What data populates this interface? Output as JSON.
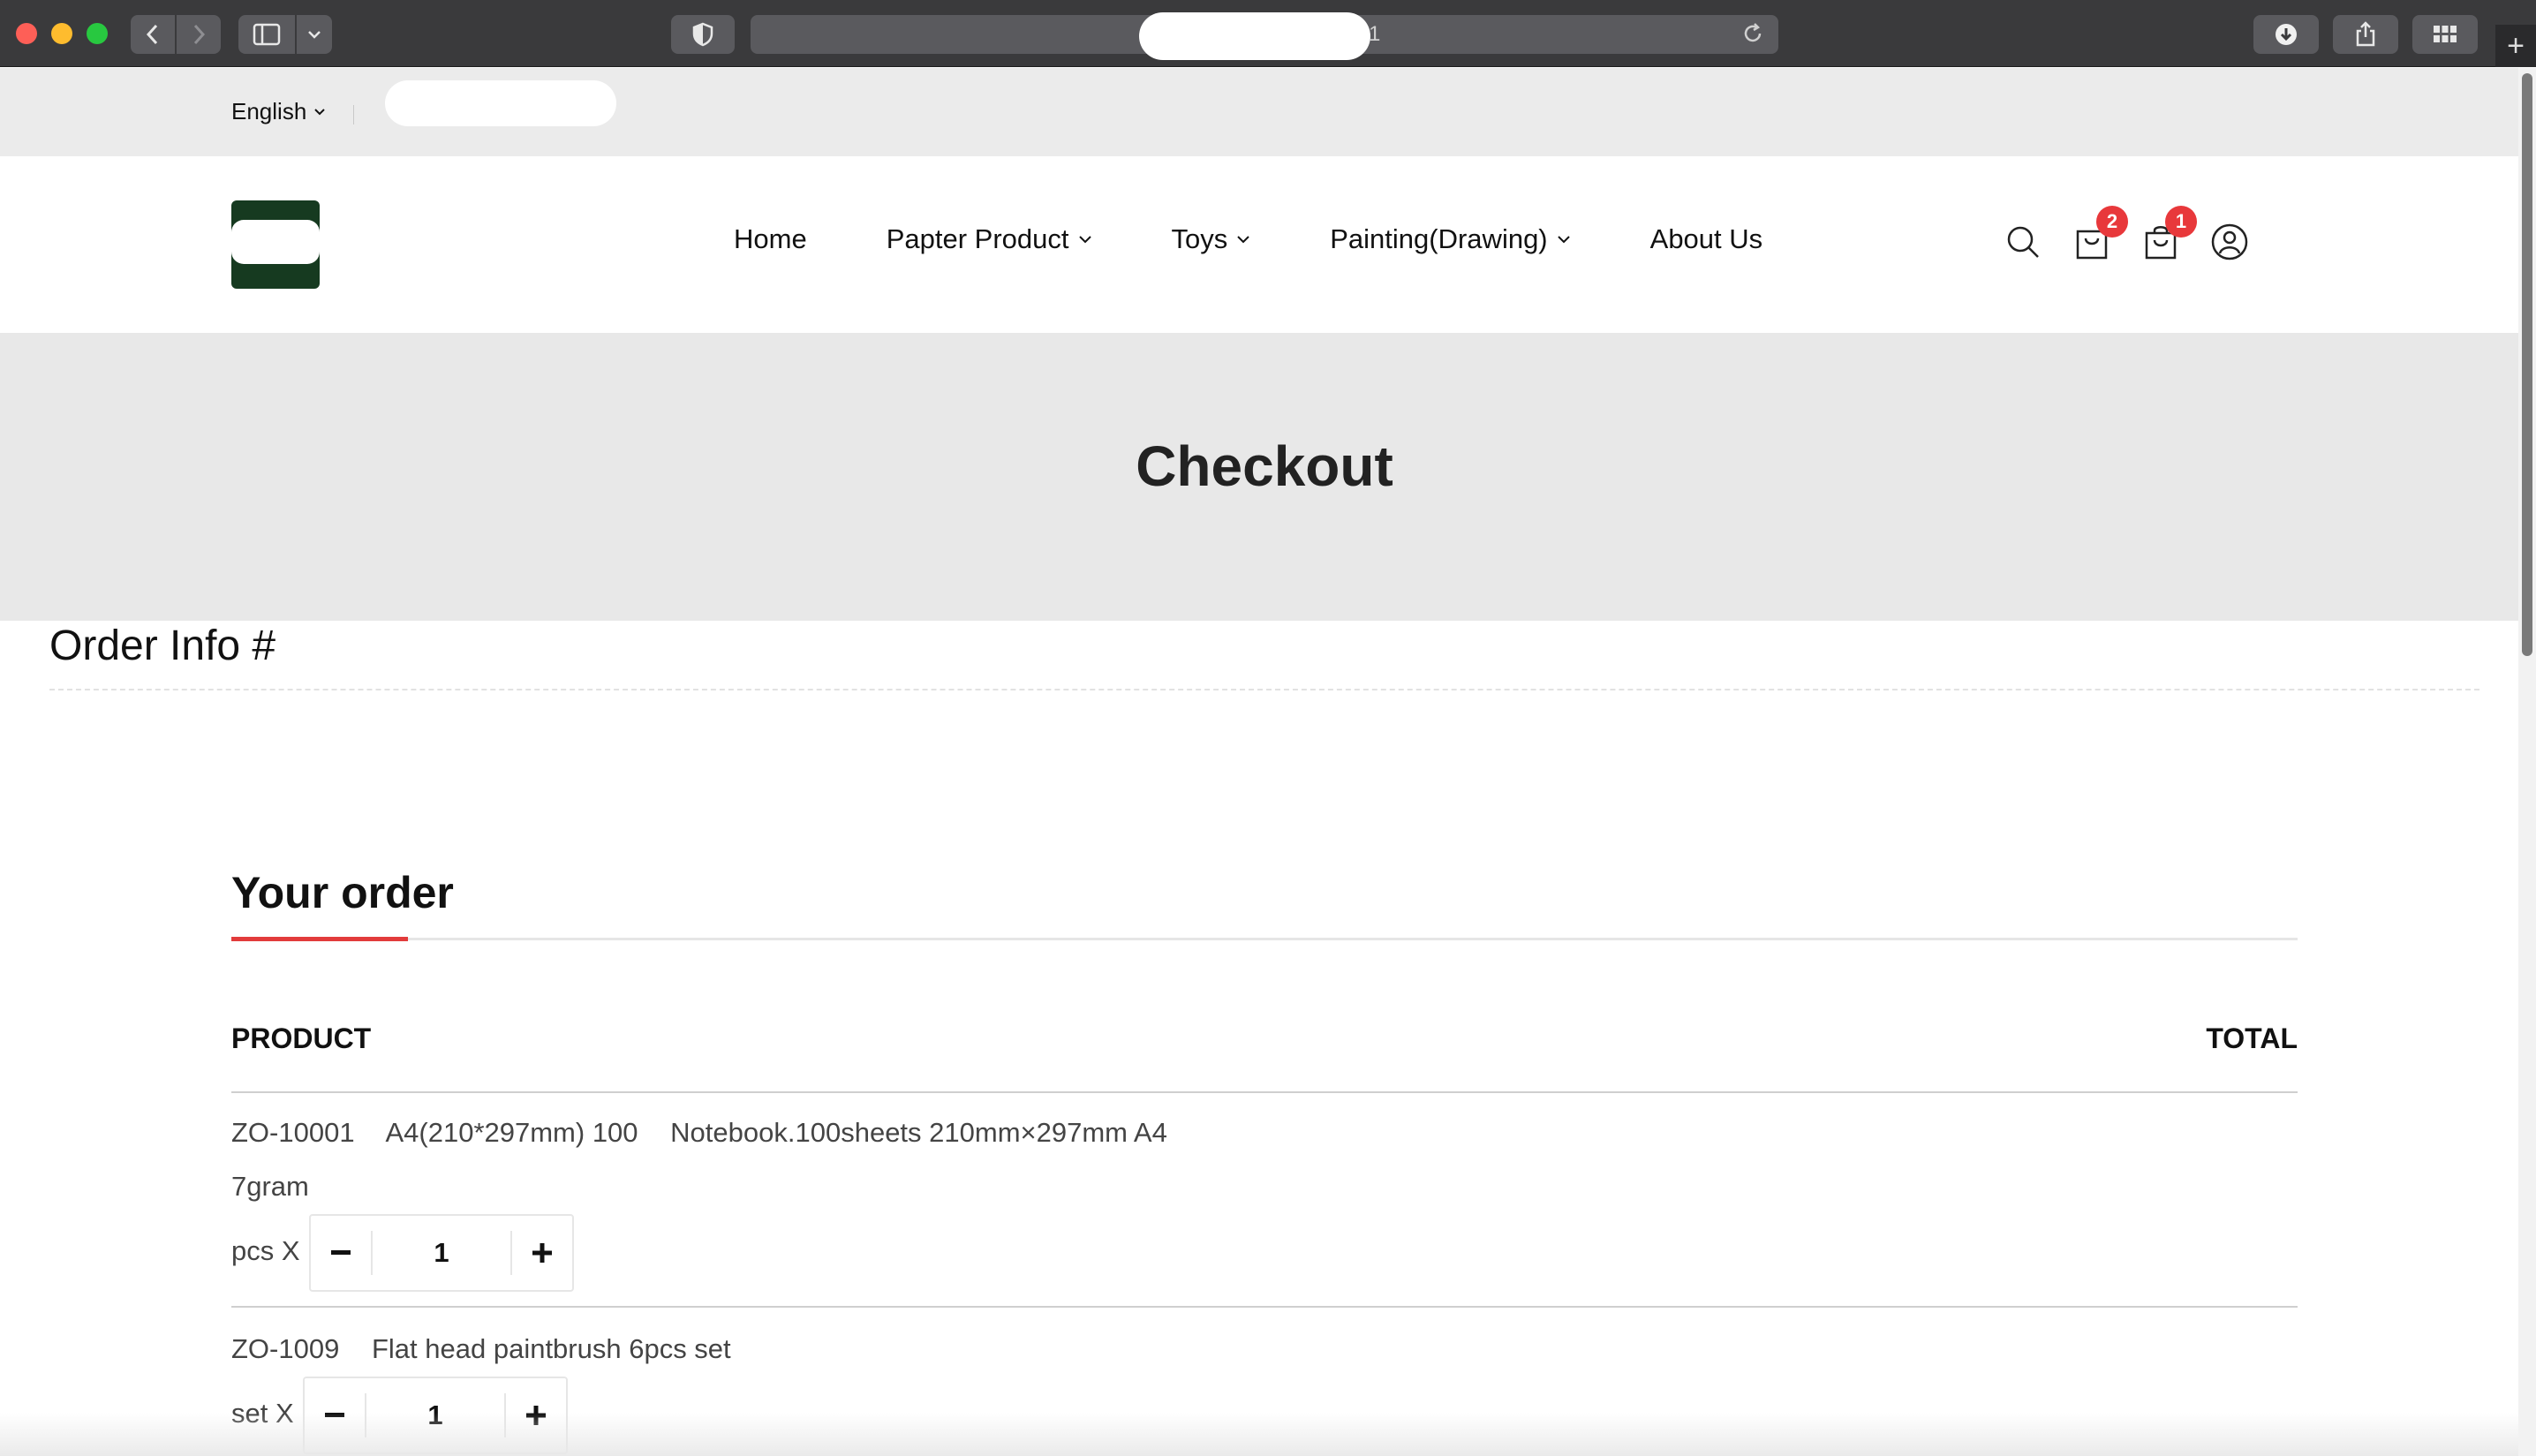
{
  "browser": {
    "address_suffix": "1",
    "back_icon": "chevron-left-icon",
    "forward_icon": "chevron-right-icon"
  },
  "topbar": {
    "language": "English"
  },
  "nav": {
    "items": [
      {
        "label": "Home",
        "dropdown": false
      },
      {
        "label": "Papter Product",
        "dropdown": true
      },
      {
        "label": "Toys",
        "dropdown": true
      },
      {
        "label": "Painting(Drawing)",
        "dropdown": true
      },
      {
        "label": "About Us",
        "dropdown": false
      }
    ]
  },
  "header_icons": {
    "wishlist_count": "2",
    "cart_count": "1"
  },
  "hero": {
    "title": "Checkout"
  },
  "order_info": {
    "title": "Order Info #"
  },
  "your_order": {
    "title": "Your order",
    "col_product": "PRODUCT",
    "col_total": "TOTAL",
    "items": [
      {
        "code": "ZO-10001",
        "size": "A4(210*297mm) 100",
        "name": "Notebook.100sheets 210mm×297mm A4",
        "extra": "7gram",
        "unit": "pcs X",
        "qty": "1"
      },
      {
        "code": "ZO-1009",
        "name": "Flat head paintbrush 6pcs set",
        "unit": "set X",
        "qty": "1"
      }
    ]
  },
  "colors": {
    "accent": "#e23b3b",
    "badge": "#e8383b",
    "logo": "#163a20",
    "hero_bg": "#e8e8e8"
  }
}
